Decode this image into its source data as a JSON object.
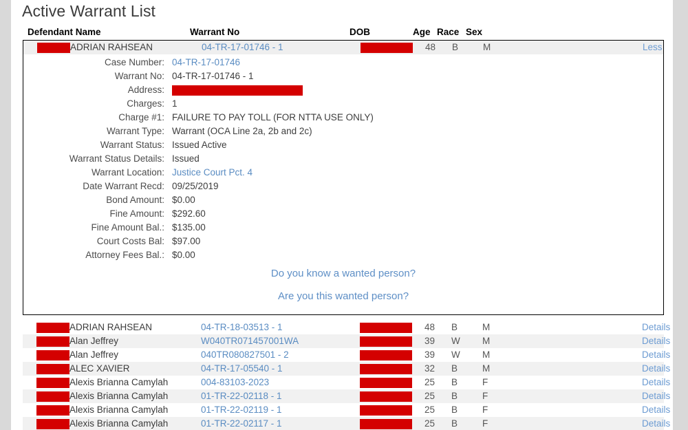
{
  "page": {
    "title": "Active Warrant List",
    "redaction_color": "#d40000",
    "link_color": "#5a8cc2"
  },
  "columns": {
    "name": "Defendant Name",
    "warrant_no": "Warrant No",
    "dob": "DOB",
    "age": "Age",
    "race": "Race",
    "sex": "Sex"
  },
  "expanded_record": {
    "name": "ADRIAN RAHSEAN",
    "warrant_no": "04-TR-17-01746 - 1",
    "dob": "",
    "age": "48",
    "race": "B",
    "sex": "M",
    "toggle_label": "Less",
    "fields": [
      {
        "label": "Case Number:",
        "value": "04-TR-17-01746",
        "kind": "link"
      },
      {
        "label": "Warrant No:",
        "value": "04-TR-17-01746 - 1",
        "kind": "text"
      },
      {
        "label": "Address:",
        "value": "",
        "kind": "redacted"
      },
      {
        "label": "Charges:",
        "value": "1",
        "kind": "text"
      },
      {
        "label": "Charge #1:",
        "value": "FAILURE TO PAY TOLL (FOR NTTA USE ONLY)",
        "kind": "text"
      },
      {
        "label": "Warrant Type:",
        "value": "Warrant (OCA Line 2a, 2b and 2c)",
        "kind": "text"
      },
      {
        "label": "Warrant Status:",
        "value": "Issued Active",
        "kind": "text"
      },
      {
        "label": "Warrant Status Details:",
        "value": "Issued",
        "kind": "text"
      },
      {
        "label": "Warrant Location:",
        "value": "Justice Court Pct. 4",
        "kind": "link"
      },
      {
        "label": "Date Warrant Recd:",
        "value": "09/25/2019",
        "kind": "text"
      },
      {
        "label": "Bond Amount:",
        "value": "$0.00",
        "kind": "text"
      },
      {
        "label": "Fine Amount:",
        "value": "$292.60",
        "kind": "text"
      },
      {
        "label": "Fine Amount Bal.:",
        "value": "$135.00",
        "kind": "text"
      },
      {
        "label": "Court Costs Bal:",
        "value": "$97.00",
        "kind": "text"
      },
      {
        "label": "Attorney Fees Bal.:",
        "value": "$0.00",
        "kind": "text"
      }
    ],
    "wanted_links": [
      "Do you know a wanted person?",
      "Are you this wanted person?"
    ]
  },
  "rows": [
    {
      "name": "ADRIAN RAHSEAN",
      "warrant_no": "04-TR-18-03513 - 1",
      "age": "48",
      "race": "B",
      "sex": "M",
      "details_label": "Details"
    },
    {
      "name": "Alan Jeffrey",
      "warrant_no": "W040TR071457001WA",
      "age": "39",
      "race": "W",
      "sex": "M",
      "details_label": "Details"
    },
    {
      "name": "Alan Jeffrey",
      "warrant_no": "040TR080827501 - 2",
      "age": "39",
      "race": "W",
      "sex": "M",
      "details_label": "Details"
    },
    {
      "name": "ALEC XAVIER",
      "warrant_no": "04-TR-17-05540 - 1",
      "age": "32",
      "race": "B",
      "sex": "M",
      "details_label": "Details"
    },
    {
      "name": "Alexis Brianna Camylah",
      "warrant_no": "004-83103-2023",
      "age": "25",
      "race": "B",
      "sex": "F",
      "details_label": "Details"
    },
    {
      "name": "Alexis Brianna Camylah",
      "warrant_no": "01-TR-22-02118 - 1",
      "age": "25",
      "race": "B",
      "sex": "F",
      "details_label": "Details"
    },
    {
      "name": "Alexis Brianna Camylah",
      "warrant_no": "01-TR-22-02119 - 1",
      "age": "25",
      "race": "B",
      "sex": "F",
      "details_label": "Details"
    },
    {
      "name": "Alexis Brianna Camylah",
      "warrant_no": "01-TR-22-02117 - 1",
      "age": "25",
      "race": "B",
      "sex": "F",
      "details_label": "Details"
    }
  ]
}
